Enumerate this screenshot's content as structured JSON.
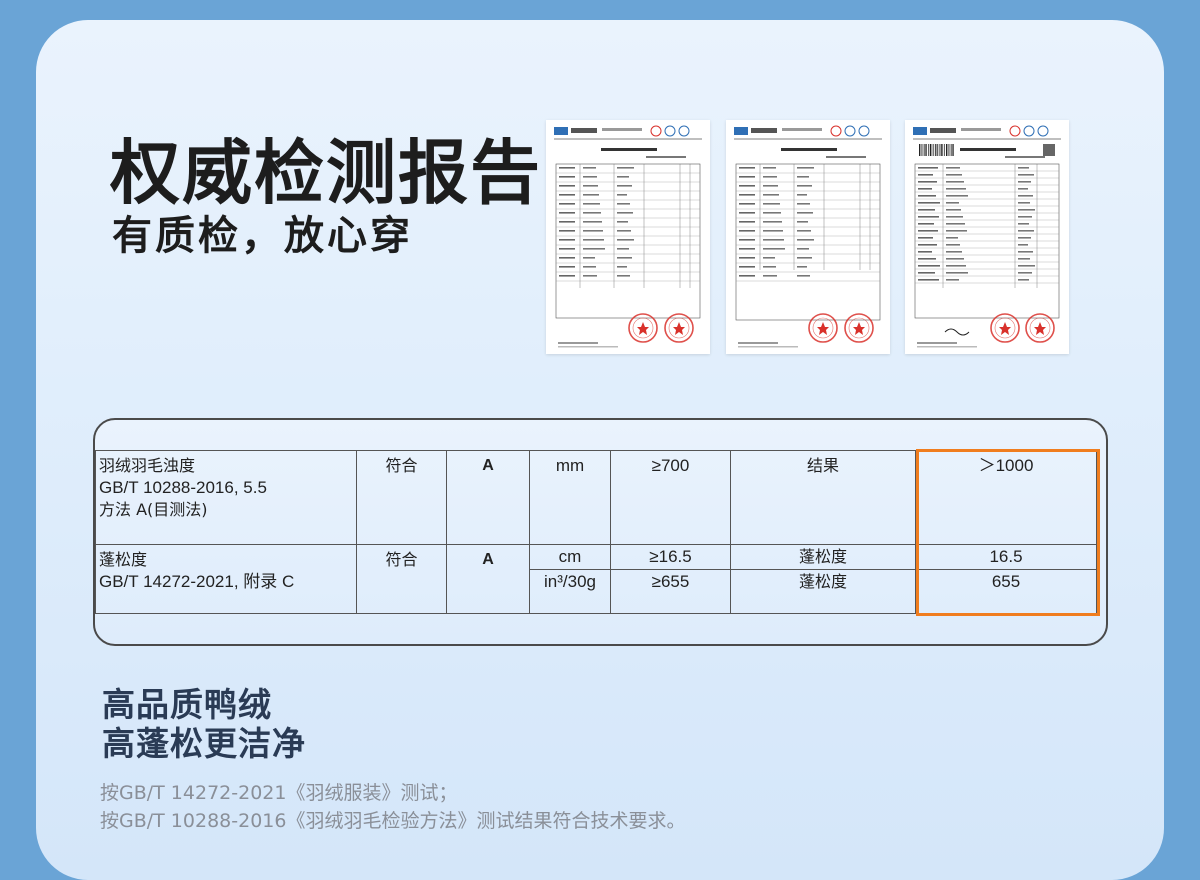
{
  "heading": {
    "title": "权威检测报告",
    "subtitle": "有质检，放心穿"
  },
  "reports": {
    "count": 3,
    "stamp_color": "#d9312b"
  },
  "spec_table": {
    "rows": [
      {
        "standard_lines": [
          "羽绒羽毛浊度",
          "GB/T 10288-2016, 5.5",
          "方法 A(目测法)"
        ],
        "verdict": "符合",
        "grade": "A",
        "unit": "mm",
        "requirement": "≥700",
        "item": "结果",
        "result": "＞1000"
      },
      {
        "standard_lines": [
          "蓬松度",
          "GB/T 14272-2021, 附录 C"
        ],
        "verdict": "符合",
        "grade": "A",
        "sub": [
          {
            "unit": "cm",
            "requirement": "≥16.5",
            "item": "蓬松度",
            "result": "16.5"
          },
          {
            "unit": "in³/30g",
            "requirement": "≥655",
            "item": "蓬松度",
            "result": "655"
          }
        ]
      }
    ],
    "highlight_color": "#f07d1e"
  },
  "features": {
    "line1": "高品质鸭绒",
    "line2": "高蓬松更洁净"
  },
  "notes": {
    "line1": "按GB/T 14272-2021《羽绒服装》测试；",
    "line2": "按GB/T 10288-2016《羽绒羽毛检验方法》测试结果符合技术要求。"
  },
  "colors": {
    "background": "#6aa4d6",
    "card": "#e2effc",
    "heading_text": "#1d1d1d",
    "feature_text": "#2a3b55",
    "note_text": "#8a8f98"
  }
}
